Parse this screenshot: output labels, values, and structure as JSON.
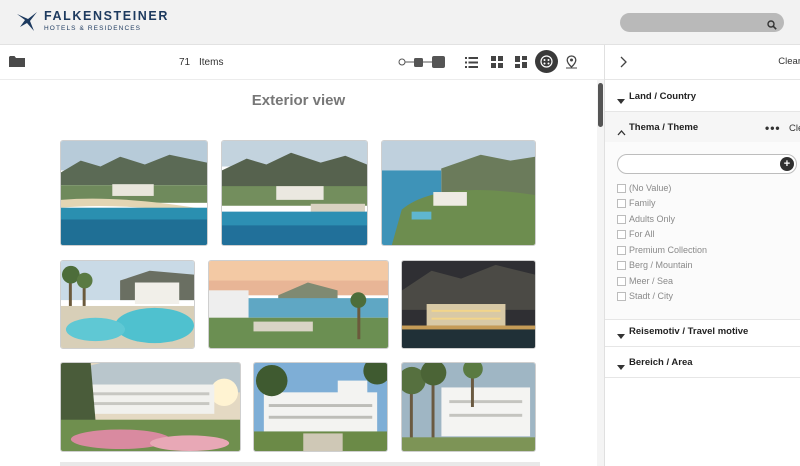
{
  "header": {
    "brand_name": "FALKENSTEINER",
    "brand_sub": "HOTELS & RESIDENCES",
    "search_placeholder": ""
  },
  "toolbar": {
    "count": "71",
    "count_label": "Items",
    "zoom_level": 0.55,
    "icons": [
      "folder-icon",
      "zoom-slider",
      "list-view-icon",
      "grid-view-icon",
      "mosaic-view-icon",
      "detail-view-icon",
      "map-view-icon"
    ]
  },
  "main": {
    "section_title": "Exterior view",
    "thumbnails": [
      "beach-resort-aerial",
      "resort-coastline-aerial",
      "cliff-hotel-aerial",
      "pool-terrace-palms",
      "seaside-terrace-sunset",
      "hotel-night-lights",
      "hotel-garden-flowers",
      "white-hotel-pines",
      "white-hotel-trees"
    ]
  },
  "panel": {
    "clear_all": "Clear",
    "facets": [
      {
        "title": "Land / Country",
        "expanded": false
      },
      {
        "title": "Thema / Theme",
        "expanded": true,
        "clear": "Cle"
      },
      {
        "title": "Reisemotiv / Travel motive",
        "expanded": false
      },
      {
        "title": "Bereich / Area",
        "expanded": false
      }
    ],
    "theme_options": [
      "(No Value)",
      "Family",
      "Adults Only",
      "For All",
      "Premium Collection",
      "Berg / Mountain",
      "Meer / Sea",
      "Stadt / City"
    ],
    "more_label": "•••"
  },
  "colors": {
    "brand": "#1d3a5f",
    "active_view": "#3a3a3a"
  }
}
